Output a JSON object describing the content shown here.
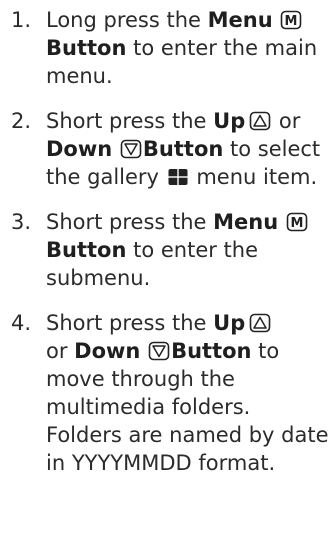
{
  "steps": [
    {
      "num": "1.",
      "a": "Long press the ",
      "b": "Menu",
      "c": " ",
      "d": "Button",
      "e": " to enter the main menu."
    },
    {
      "num": "2.",
      "a": "Short press the ",
      "b": "Up",
      "c": " or ",
      "d": "Down",
      "e": " ",
      "f": "Button",
      "g": " to select the gallery ",
      "h": " menu item."
    },
    {
      "num": "3.",
      "a": "Short press the ",
      "b": "Menu",
      "c": " ",
      "d": "Button",
      "e": " to enter the submenu."
    },
    {
      "num": "4.",
      "a": "Short press the ",
      "b": "Up",
      "c": " or ",
      "d": "Down",
      "e": " ",
      "f": "Button",
      "g": " to move through the multimedia folders. Folders are named by date in YYYYMMDD format."
    }
  ],
  "icons": {
    "menu": "menu-button-icon",
    "up": "up-button-icon",
    "down": "down-button-icon",
    "gallery": "gallery-icon"
  },
  "colors": {
    "text": "#2b2b2b",
    "icon": "#222222"
  }
}
